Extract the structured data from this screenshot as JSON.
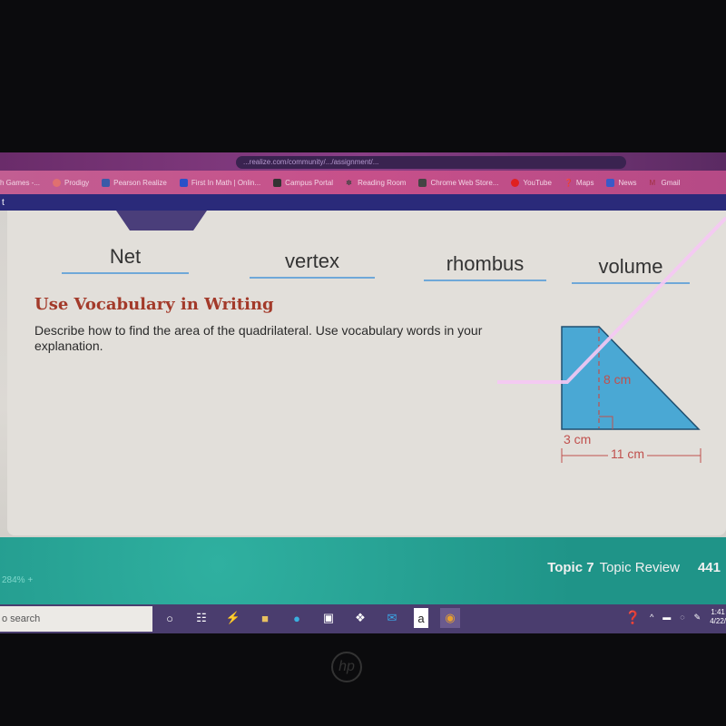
{
  "browser": {
    "url": "...realize.com/community/.../assignment/...",
    "bookmarks": [
      "h Games -...",
      "Prodigy",
      "Pearson Realize",
      "First In Math | Onlin...",
      "Campus Portal",
      "Reading Room",
      "Chrome Web Store...",
      "YouTube",
      "Maps",
      "News",
      "Gmail"
    ],
    "tab_fragment": "t"
  },
  "vocab_words": [
    "Net",
    "vertex",
    "rhombus",
    "volume"
  ],
  "exercise": {
    "heading": "Use Vocabulary in Writing",
    "prompt": "Describe how to find the area of the quadrilateral. Use vocabulary words in your explanation."
  },
  "figure": {
    "height_label": "8 cm",
    "top_label": "3 cm",
    "base_label": "11 cm",
    "fill_color": "#4aa8d4",
    "label_color": "#c0504d"
  },
  "footer": {
    "zoom": "284%",
    "zoom_plus": "+",
    "topic": "Topic 7",
    "section": "Topic Review",
    "page": "441"
  },
  "taskbar": {
    "search_placeholder": "o search",
    "time": "1:41",
    "date": "4/22/"
  },
  "laptop_logo": "hp"
}
